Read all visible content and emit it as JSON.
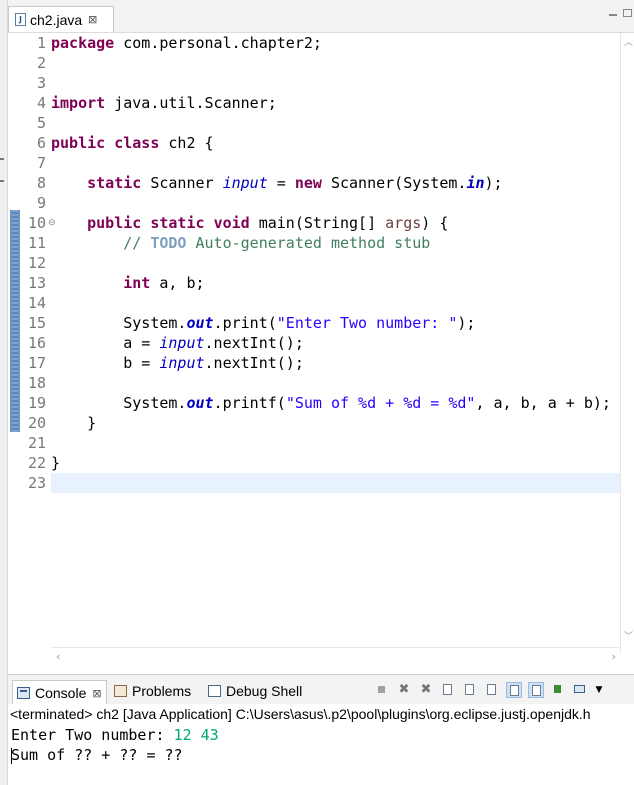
{
  "editor_tab": {
    "icon": "java-file-icon",
    "icon_glyph": "J",
    "label": "ch2.java",
    "close": "⊠"
  },
  "line_numbers": [
    "1",
    "2",
    "3",
    "4",
    "5",
    "6",
    "7",
    "8",
    "9",
    "10",
    "11",
    "12",
    "13",
    "14",
    "15",
    "16",
    "17",
    "18",
    "19",
    "20",
    "21",
    "22",
    "23"
  ],
  "code": {
    "l1_kw": "package",
    "l1_rest": " com.personal.chapter2;",
    "l4_kw": "import",
    "l4_rest": " java.util.Scanner;",
    "l6_kw1": "public",
    "l6_kw2": "class",
    "l6_rest": " ch2 {",
    "l8_kw1": "static",
    "l8_type": " Scanner ",
    "l8_field": "input",
    "l8_eq": " = ",
    "l8_kw2": "new",
    "l8_call": " Scanner(System.",
    "l8_in": "in",
    "l8_end": ");",
    "l10_kw1": "public",
    "l10_kw2": "static",
    "l10_kw3": "void",
    "l10_sig": " main(String[] ",
    "l10_param": "args",
    "l10_end": ") {",
    "l11_cmt1": "// ",
    "l11_todo": "TODO",
    "l11_cmt2": " Auto-generated method stub",
    "l13_kw": "int",
    "l13_rest": " a, b;",
    "l15_a": "System.",
    "l15_out": "out",
    "l15_b": ".print(",
    "l15_str": "\"Enter Two number: \"",
    "l15_c": ");",
    "l16_a": "a = ",
    "l16_field": "input",
    "l16_b": ".nextInt();",
    "l17_a": "b = ",
    "l17_field": "input",
    "l17_b": ".nextInt();",
    "l19_a": "System.",
    "l19_out": "out",
    "l19_b": ".printf(",
    "l19_str": "\"Sum of %d + %d = %d\"",
    "l19_c": ", a, b, a + b);",
    "l20": "}",
    "l22": "}"
  },
  "console": {
    "tabs": {
      "console": "Console",
      "problems": "Problems",
      "debug_shell": "Debug Shell"
    },
    "terminated": "<terminated> ch2 [Java Application] C:\\Users\\asus\\.p2\\pool\\plugins\\org.eclipse.justj.openjdk.h",
    "output_prompt": "Enter Two number: ",
    "output_input": "12 43",
    "output_result": "Sum of ?? + ?? = ??"
  },
  "toolbar_icons": [
    "terminate-icon",
    "remove-launch-icon",
    "remove-all-terminated-icon",
    "clear-console-icon",
    "scroll-lock-icon",
    "word-wrap-icon",
    "show-on-stdout-icon",
    "show-on-stderr-icon",
    "pin-console-icon",
    "display-console-icon"
  ],
  "colors": {
    "keyword": "#7f0055",
    "field": "#0000c0",
    "string": "#2a00ff",
    "comment": "#3f7f5f",
    "todo": "#7f9fbf",
    "console_input": "#00a86b",
    "current_line": "#e8f2fe"
  }
}
